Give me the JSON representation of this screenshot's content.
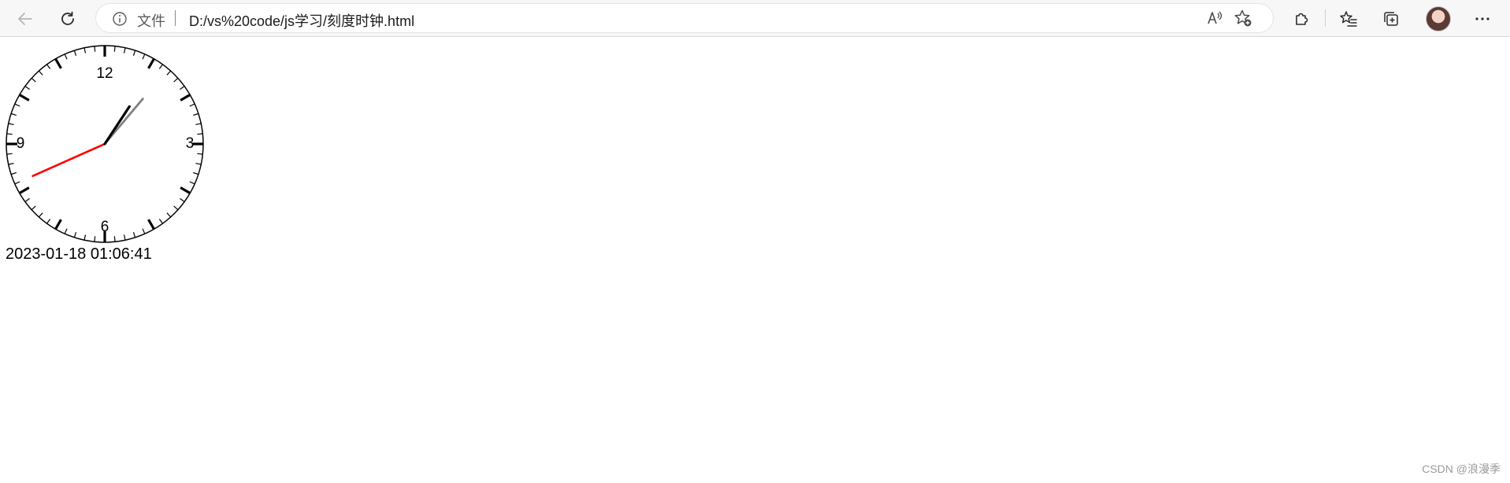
{
  "browser": {
    "address_label": "文件",
    "url": "D:/vs%20code/js学习/刻度时钟.html",
    "icons": {
      "back": "back-arrow-icon",
      "refresh": "refresh-icon",
      "info": "info-icon",
      "read_aloud": "read-aloud-icon",
      "favorite_add": "add-favorite-icon",
      "extensions": "extensions-icon",
      "favorites": "favorites-icon",
      "collections": "collections-icon",
      "profile": "profile-avatar",
      "more": "more-menu-icon"
    }
  },
  "clock": {
    "numerals": {
      "twelve": "12",
      "three": "3",
      "six": "6",
      "nine": "9"
    },
    "time": {
      "hour": 1,
      "minute": 6,
      "second": 41
    },
    "datetime_text": "2023-01-18 01:06:41",
    "colors": {
      "hour_hand": "#000000",
      "minute_hand": "#808080",
      "second_hand": "#ff0000",
      "ticks": "#000000",
      "face": "#ffffff"
    }
  },
  "watermark": "CSDN @浪漫季"
}
